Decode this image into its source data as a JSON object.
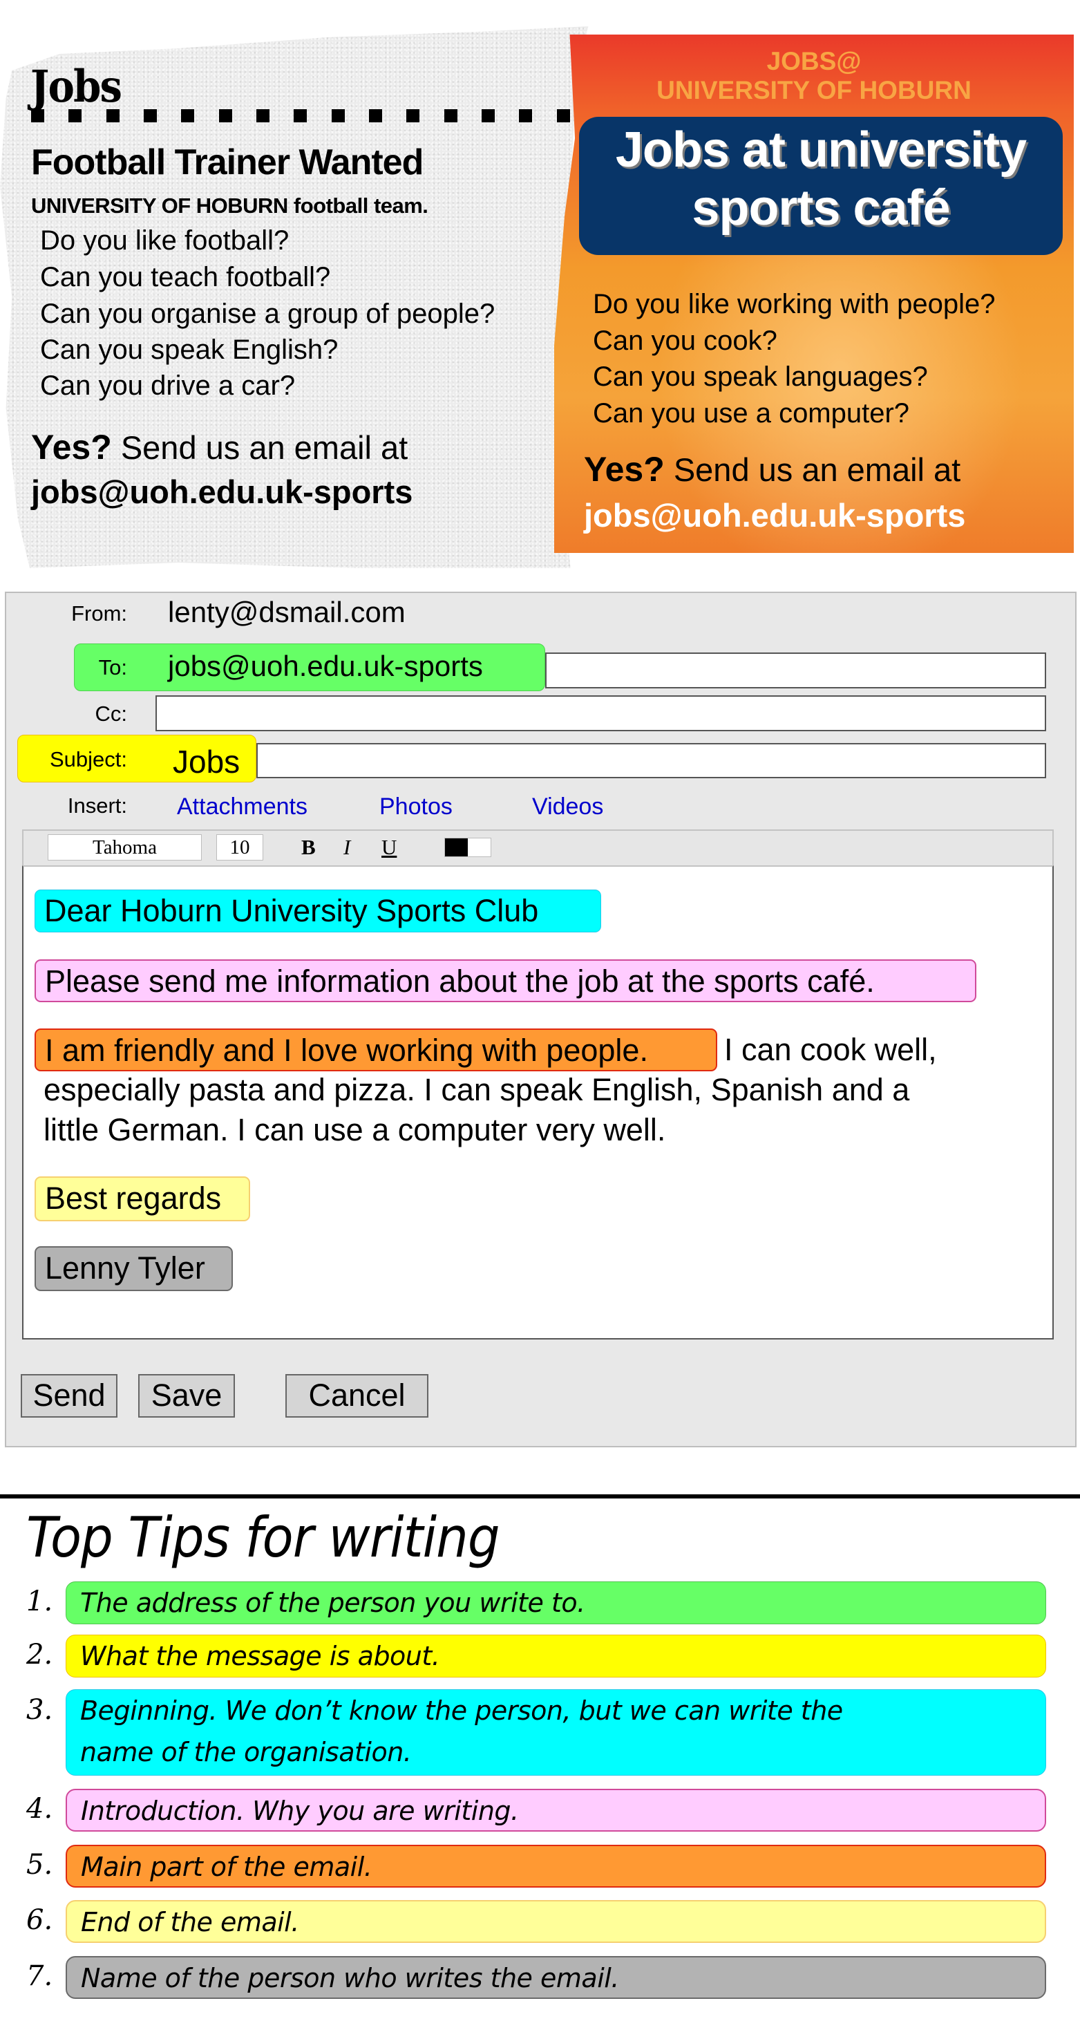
{
  "left_ad": {
    "heading": "Jobs",
    "title": "Football Trainer Wanted",
    "subtitle": "UNIVERSITY OF HOBURN football team.",
    "questions": [
      "Do you like football?",
      "Can you teach football?",
      "Can you organise a group of people?",
      "Can you speak English?",
      "Can you drive a car?"
    ],
    "yes": "Yes?",
    "cta": "Send us an email at",
    "email": "jobs@uoh.edu.uk-sports"
  },
  "right_ad": {
    "kicker_line1": "JOBS@",
    "kicker_line2": "UNIVERSITY OF HOBURN",
    "title_line1": "Jobs at university",
    "title_line2": "sports café",
    "questions": [
      "Do you like working with people?",
      "Can you cook?",
      "Can you speak languages?",
      "Can you use a computer?"
    ],
    "yes": "Yes?",
    "cta": "Send us an email at",
    "email": "jobs@uoh.edu.uk-sports",
    "colors": {
      "panel": "#f39a2c",
      "title_box": "#083568",
      "kicker": "#f8a544"
    }
  },
  "email_form": {
    "from_label": "From:",
    "from_value": "lenty@dsmail.com",
    "to_label": "To:",
    "to_value": "jobs@uoh.edu.uk-sports",
    "cc_label": "Cc:",
    "cc_value": "",
    "subject_label": "Subject:",
    "subject_value": "Jobs",
    "insert_label": "Insert:",
    "insert_links": [
      "Attachments",
      "Photos",
      "Videos"
    ],
    "toolbar": {
      "font": "Tahoma",
      "size": "10",
      "bold": "B",
      "italic": "I",
      "underline": "U"
    },
    "body": {
      "greeting": "Dear Hoburn University Sports Club",
      "introduction": "Please send me information about the job at the sports café.",
      "main_highlight": "I am friendly and I love working with people.",
      "main_rest_line1": "I can cook well,",
      "main_line2": "especially pasta and pizza. I can speak English, Spanish and a",
      "main_line3": "little German. I can use a computer very well.",
      "closing": "Best regards",
      "signature": "Lenny Tyler"
    },
    "buttons": {
      "send": "Send",
      "save": "Save",
      "cancel": "Cancel"
    },
    "highlight_colors": {
      "to": "#66ff66",
      "subject": "#ffff00",
      "greeting": "#00ffff",
      "introduction": "#ffccff",
      "main": "#ff9933",
      "closing": "#ffff99",
      "signature": "#b3b3b3"
    }
  },
  "tips": {
    "title": "Top Tips for writing",
    "items": [
      {
        "num": "1.",
        "text": "The address of the person you write to.",
        "color": "#66ff66"
      },
      {
        "num": "2.",
        "text": "What the message is about.",
        "color": "#ffff00"
      },
      {
        "num": "3.",
        "text": "Beginning. We don’t know the person, but we can write the name of the organisation.",
        "text_line1": "Beginning. We don’t know the person, but we can write the",
        "text_line2": "name of the organisation.",
        "color": "#00ffff"
      },
      {
        "num": "4.",
        "text": "Introduction. Why you are writing.",
        "color": "#ffccff"
      },
      {
        "num": "5.",
        "text": "Main part of the email.",
        "color": "#ff9933"
      },
      {
        "num": "6.",
        "text": "End of the email.",
        "color": "#ffff99"
      },
      {
        "num": "7.",
        "text": "Name of the person who writes the email.",
        "color": "#b3b3b3"
      }
    ]
  }
}
